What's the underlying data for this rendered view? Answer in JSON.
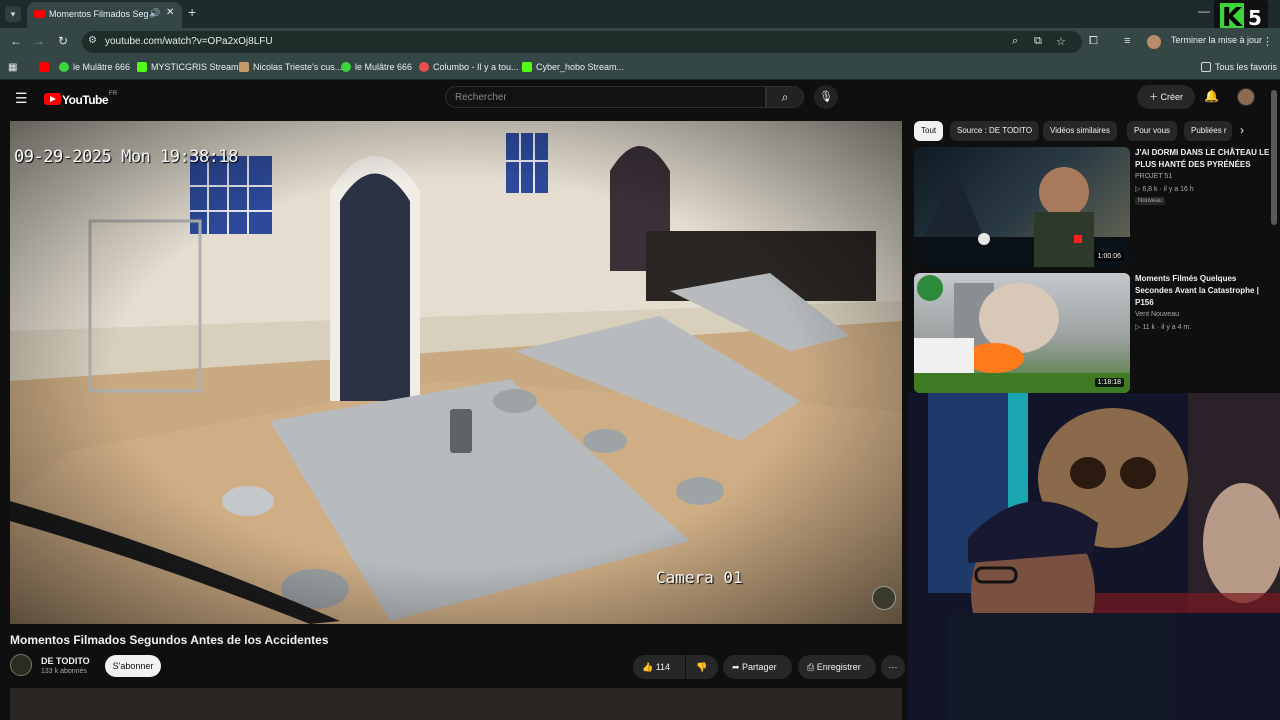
{
  "browser": {
    "tab_title": "Momentos Filmados Segun",
    "url": "youtube.com/watch?v=OPa2xOj8LFU",
    "update_label": "Terminer la mise à jour",
    "bookmarks": [
      {
        "label": "le Mulâtre 666",
        "icon": "green-play-icon",
        "color": "#3bd43a"
      },
      {
        "label": "MYSTICGRIS Stream...",
        "icon": "kick-icon",
        "color": "#53fc18"
      },
      {
        "label": "Nicolas Trieste's cus...",
        "icon": "goat-icon",
        "color": "#c79a6a"
      },
      {
        "label": "le Mulâtre 666",
        "icon": "green-play-icon",
        "color": "#3bd43a"
      },
      {
        "label": "Columbo - Il y a tou...",
        "icon": "columbo-icon",
        "color": "#e85050"
      },
      {
        "label": "Cyber_hobo Stream...",
        "icon": "kick-icon",
        "color": "#53fc18"
      }
    ],
    "all_bookmarks": "Tous les favoris"
  },
  "overlay": {
    "logo_letter": "K",
    "logo_number": "5"
  },
  "youtube": {
    "logo": "YouTube",
    "country": "FR",
    "search_placeholder": "Rechercher",
    "create_label": "Créer"
  },
  "video": {
    "timestamp": "09-29-2025 Mon 19:38:18",
    "camera_label": "Camera 01",
    "title": "Momentos Filmados Segundos Antes de los Accidentes",
    "channel": "DE TODITO",
    "subscribers": "133 k abonnés",
    "subscribe_label": "S'abonner",
    "likes": "114",
    "share_label": "Partager",
    "save_label": "Enregistrer"
  },
  "chips": [
    {
      "label": "Tout",
      "active": true
    },
    {
      "label": "Source : DE TODITO",
      "active": false
    },
    {
      "label": "Vidéos similaires",
      "active": false
    },
    {
      "label": "Pour vous",
      "active": false
    },
    {
      "label": "Publiées r",
      "active": false
    }
  ],
  "recommendations": [
    {
      "title": "J'AI DORMI DANS LE CHÂTEAU LE PLUS HANTÉ DES PYRÉNÉES",
      "channel": "PROJET 51",
      "meta": "▷ 6,8 k · il y a 16 h",
      "badge": "Nouveau",
      "duration": "1:00:06"
    },
    {
      "title": "Moments Filmés Quelques Secondes Avant la Catastrophe | P156",
      "channel": "Vent Nouveau",
      "meta": "▷ 11 k · il y a 4 m.",
      "badge": "",
      "duration": "1:18:18"
    }
  ]
}
